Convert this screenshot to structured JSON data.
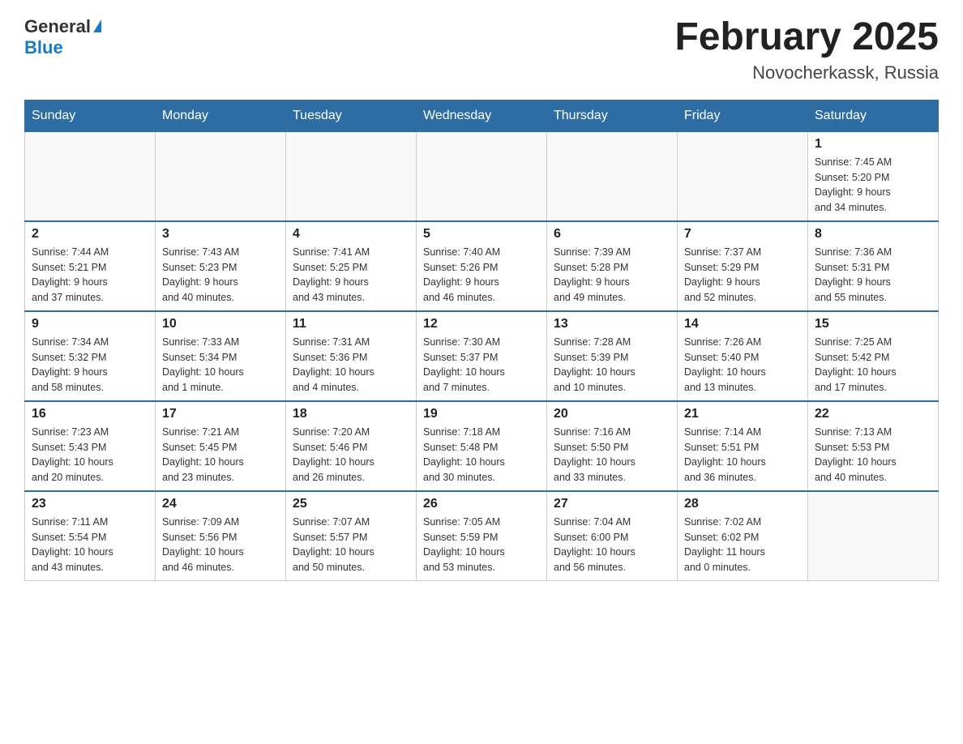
{
  "header": {
    "logo_general": "General",
    "logo_blue": "Blue",
    "title": "February 2025",
    "subtitle": "Novocherkassk, Russia"
  },
  "days_of_week": [
    "Sunday",
    "Monday",
    "Tuesday",
    "Wednesday",
    "Thursday",
    "Friday",
    "Saturday"
  ],
  "weeks": [
    [
      {
        "day": "",
        "info": ""
      },
      {
        "day": "",
        "info": ""
      },
      {
        "day": "",
        "info": ""
      },
      {
        "day": "",
        "info": ""
      },
      {
        "day": "",
        "info": ""
      },
      {
        "day": "",
        "info": ""
      },
      {
        "day": "1",
        "info": "Sunrise: 7:45 AM\nSunset: 5:20 PM\nDaylight: 9 hours\nand 34 minutes."
      }
    ],
    [
      {
        "day": "2",
        "info": "Sunrise: 7:44 AM\nSunset: 5:21 PM\nDaylight: 9 hours\nand 37 minutes."
      },
      {
        "day": "3",
        "info": "Sunrise: 7:43 AM\nSunset: 5:23 PM\nDaylight: 9 hours\nand 40 minutes."
      },
      {
        "day": "4",
        "info": "Sunrise: 7:41 AM\nSunset: 5:25 PM\nDaylight: 9 hours\nand 43 minutes."
      },
      {
        "day": "5",
        "info": "Sunrise: 7:40 AM\nSunset: 5:26 PM\nDaylight: 9 hours\nand 46 minutes."
      },
      {
        "day": "6",
        "info": "Sunrise: 7:39 AM\nSunset: 5:28 PM\nDaylight: 9 hours\nand 49 minutes."
      },
      {
        "day": "7",
        "info": "Sunrise: 7:37 AM\nSunset: 5:29 PM\nDaylight: 9 hours\nand 52 minutes."
      },
      {
        "day": "8",
        "info": "Sunrise: 7:36 AM\nSunset: 5:31 PM\nDaylight: 9 hours\nand 55 minutes."
      }
    ],
    [
      {
        "day": "9",
        "info": "Sunrise: 7:34 AM\nSunset: 5:32 PM\nDaylight: 9 hours\nand 58 minutes."
      },
      {
        "day": "10",
        "info": "Sunrise: 7:33 AM\nSunset: 5:34 PM\nDaylight: 10 hours\nand 1 minute."
      },
      {
        "day": "11",
        "info": "Sunrise: 7:31 AM\nSunset: 5:36 PM\nDaylight: 10 hours\nand 4 minutes."
      },
      {
        "day": "12",
        "info": "Sunrise: 7:30 AM\nSunset: 5:37 PM\nDaylight: 10 hours\nand 7 minutes."
      },
      {
        "day": "13",
        "info": "Sunrise: 7:28 AM\nSunset: 5:39 PM\nDaylight: 10 hours\nand 10 minutes."
      },
      {
        "day": "14",
        "info": "Sunrise: 7:26 AM\nSunset: 5:40 PM\nDaylight: 10 hours\nand 13 minutes."
      },
      {
        "day": "15",
        "info": "Sunrise: 7:25 AM\nSunset: 5:42 PM\nDaylight: 10 hours\nand 17 minutes."
      }
    ],
    [
      {
        "day": "16",
        "info": "Sunrise: 7:23 AM\nSunset: 5:43 PM\nDaylight: 10 hours\nand 20 minutes."
      },
      {
        "day": "17",
        "info": "Sunrise: 7:21 AM\nSunset: 5:45 PM\nDaylight: 10 hours\nand 23 minutes."
      },
      {
        "day": "18",
        "info": "Sunrise: 7:20 AM\nSunset: 5:46 PM\nDaylight: 10 hours\nand 26 minutes."
      },
      {
        "day": "19",
        "info": "Sunrise: 7:18 AM\nSunset: 5:48 PM\nDaylight: 10 hours\nand 30 minutes."
      },
      {
        "day": "20",
        "info": "Sunrise: 7:16 AM\nSunset: 5:50 PM\nDaylight: 10 hours\nand 33 minutes."
      },
      {
        "day": "21",
        "info": "Sunrise: 7:14 AM\nSunset: 5:51 PM\nDaylight: 10 hours\nand 36 minutes."
      },
      {
        "day": "22",
        "info": "Sunrise: 7:13 AM\nSunset: 5:53 PM\nDaylight: 10 hours\nand 40 minutes."
      }
    ],
    [
      {
        "day": "23",
        "info": "Sunrise: 7:11 AM\nSunset: 5:54 PM\nDaylight: 10 hours\nand 43 minutes."
      },
      {
        "day": "24",
        "info": "Sunrise: 7:09 AM\nSunset: 5:56 PM\nDaylight: 10 hours\nand 46 minutes."
      },
      {
        "day": "25",
        "info": "Sunrise: 7:07 AM\nSunset: 5:57 PM\nDaylight: 10 hours\nand 50 minutes."
      },
      {
        "day": "26",
        "info": "Sunrise: 7:05 AM\nSunset: 5:59 PM\nDaylight: 10 hours\nand 53 minutes."
      },
      {
        "day": "27",
        "info": "Sunrise: 7:04 AM\nSunset: 6:00 PM\nDaylight: 10 hours\nand 56 minutes."
      },
      {
        "day": "28",
        "info": "Sunrise: 7:02 AM\nSunset: 6:02 PM\nDaylight: 11 hours\nand 0 minutes."
      },
      {
        "day": "",
        "info": ""
      }
    ]
  ]
}
